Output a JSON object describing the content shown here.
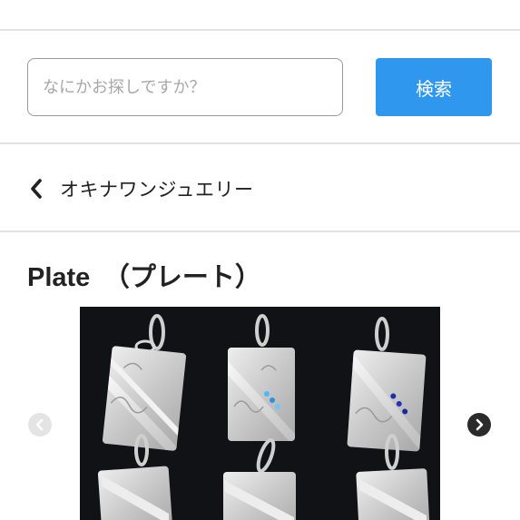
{
  "search": {
    "placeholder": "なにかお探しですか？",
    "button_label": "検索"
  },
  "breadcrumb": {
    "back_label": "オキナワンジュエリー"
  },
  "page": {
    "title": "Plate　（プレート）"
  },
  "carousel": {
    "image_subject": "engraved silver plate pendants on black background",
    "prev_icon": "chevron-left-icon",
    "next_icon": "chevron-right-icon"
  },
  "colors": {
    "accent": "#2f98ee",
    "divider": "#e3e3e3",
    "text": "#222222"
  }
}
